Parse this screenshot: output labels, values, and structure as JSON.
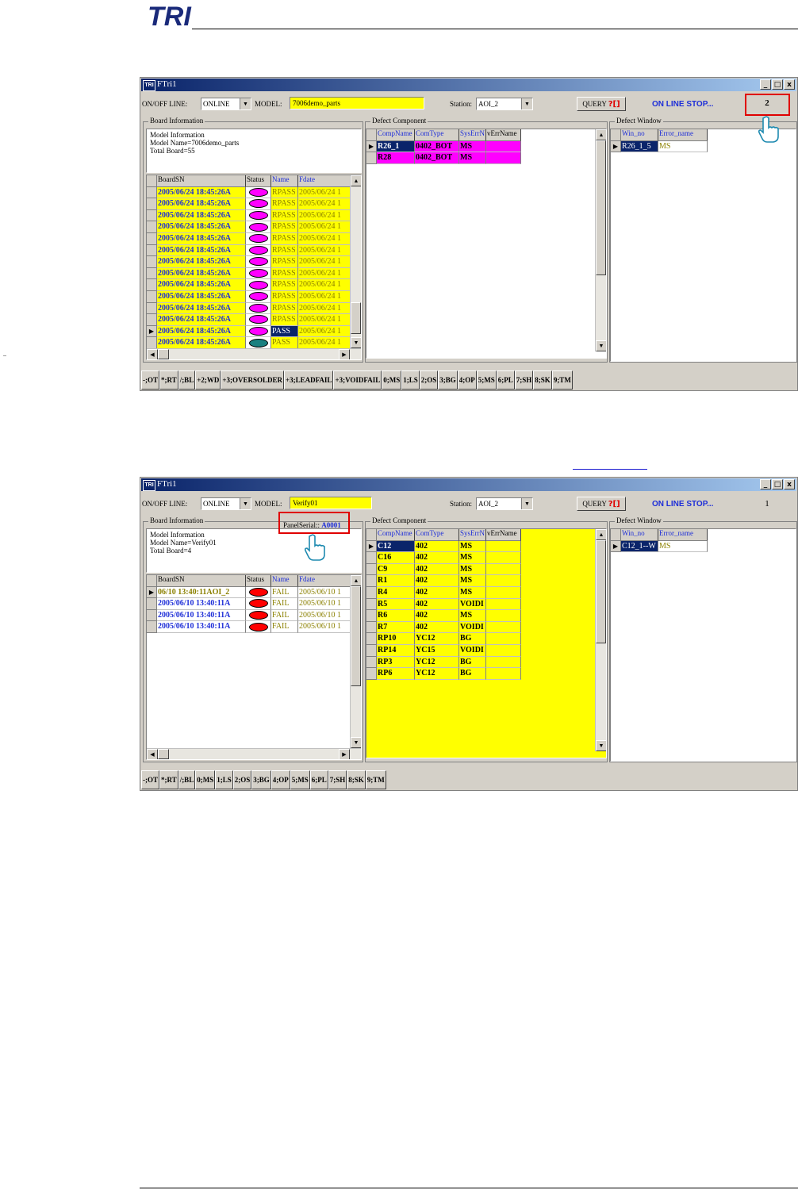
{
  "page": {
    "logo_text": "TRI"
  },
  "colors": {
    "title_gradient_start": "#0a246a",
    "title_gradient_end": "#a6caf0",
    "status_text": "#1e2ed8",
    "highlight": "#e00000",
    "magenta": "#ff00ff",
    "yellow": "#ffff00",
    "window_bg": "#d4d0c8"
  },
  "screen1": {
    "title": "FTri1",
    "title_icon": "TRI",
    "window_buttons": [
      "_",
      "□",
      "x"
    ],
    "online_label": "ON/OFF LINE:",
    "online_value": "ONLINE",
    "model_label": "MODEL:",
    "model_value": "7006demo_parts",
    "station_label": "Station:",
    "station_value": "AOI_2",
    "query_label": "QUERY",
    "query_icon": "?[]",
    "status_text": "ON LINE STOP...",
    "count": "2",
    "board_group": "Board Information",
    "board_info": [
      "Model Information",
      "Model Name=7006demo_parts",
      "Total Board=55"
    ],
    "board_headers": [
      "BoardSN",
      "Status",
      "Name",
      "Fdate"
    ],
    "board_rows": [
      {
        "sn": "2005/06/24 18:45:26A",
        "oval": "magenta",
        "name": "RPASS",
        "fdate": "2005/06/24 1"
      },
      {
        "sn": "2005/06/24 18:45:26A",
        "oval": "magenta",
        "name": "RPASS",
        "fdate": "2005/06/24 1"
      },
      {
        "sn": "2005/06/24 18:45:26A",
        "oval": "magenta",
        "name": "RPASS",
        "fdate": "2005/06/24 1"
      },
      {
        "sn": "2005/06/24 18:45:26A",
        "oval": "magenta",
        "name": "RPASS",
        "fdate": "2005/06/24 1"
      },
      {
        "sn": "2005/06/24 18:45:26A",
        "oval": "magenta",
        "name": "RPASS",
        "fdate": "2005/06/24 1"
      },
      {
        "sn": "2005/06/24 18:45:26A",
        "oval": "magenta",
        "name": "RPASS",
        "fdate": "2005/06/24 1"
      },
      {
        "sn": "2005/06/24 18:45:26A",
        "oval": "magenta",
        "name": "RPASS",
        "fdate": "2005/06/24 1"
      },
      {
        "sn": "2005/06/24 18:45:26A",
        "oval": "magenta",
        "name": "RPASS",
        "fdate": "2005/06/24 1"
      },
      {
        "sn": "2005/06/24 18:45:26A",
        "oval": "magenta",
        "name": "RPASS",
        "fdate": "2005/06/24 1"
      },
      {
        "sn": "2005/06/24 18:45:26A",
        "oval": "magenta",
        "name": "RPASS",
        "fdate": "2005/06/24 1"
      },
      {
        "sn": "2005/06/24 18:45:26A",
        "oval": "magenta",
        "name": "RPASS",
        "fdate": "2005/06/24 1"
      },
      {
        "sn": "2005/06/24 18:45:26A",
        "oval": "magenta",
        "name": "RPASS",
        "fdate": "2005/06/24 1"
      },
      {
        "sn": "2005/06/24 18:45:26A",
        "oval": "magenta",
        "name": "PASS",
        "fdate": "2005/06/24 1"
      },
      {
        "sn": "2005/06/24 18:45:26A",
        "oval": "teal",
        "name": "PASS",
        "fdate": "2005/06/24 1"
      }
    ],
    "defect_group": "Defect Component",
    "defect_headers": [
      "CompName",
      "ComType",
      "SysErrN",
      "vErrName"
    ],
    "defect_rows": [
      [
        "R26_1",
        "0402_BOT",
        "MS",
        ""
      ],
      [
        "R28",
        "0402_BOT",
        "MS",
        ""
      ]
    ],
    "window_group": "Defect Window",
    "window_headers": [
      "Win_no",
      "Error_name"
    ],
    "window_rows": [
      [
        "R26_1_5",
        "MS"
      ]
    ],
    "keys": [
      "-;OT",
      "*;RT",
      "/;BL",
      "+2;WD",
      "+3;OVERSOLDER",
      "+3;LEADFAIL",
      "+3;VOIDFAIL",
      "0;MS",
      "1;LS",
      "2;OS",
      "3;BG",
      "4;OP",
      "5;MS",
      "6;PL",
      "7;SH",
      "8;SK",
      "9;TM"
    ]
  },
  "screen2": {
    "title": "FTri1",
    "title_icon": "TRI",
    "window_buttons": [
      "_",
      "□",
      "x"
    ],
    "online_label": "ON/OFF LINE:",
    "online_value": "ONLINE",
    "model_label": "MODEL:",
    "model_value": "Verify01",
    "station_label": "Station:",
    "station_value": "AOI_2",
    "query_label": "QUERY",
    "query_icon": "?[]",
    "status_text": "ON LINE STOP...",
    "count": "1",
    "panel_serial_label": "PanelSerial::",
    "panel_serial_value": "A0001",
    "board_group": "Board Information",
    "board_info": [
      "Model Information",
      "Model Name=Verify01",
      "Total Board=4"
    ],
    "board_headers": [
      "BoardSN",
      "Status",
      "Name",
      "Fdate"
    ],
    "board_rows": [
      {
        "sn": "06/10 13:40:11AOI_2",
        "oval": "red",
        "name": "FAIL",
        "fdate": "2005/06/10 1"
      },
      {
        "sn": "2005/06/10 13:40:11A",
        "oval": "red",
        "name": "FAIL",
        "fdate": "2005/06/10 1"
      },
      {
        "sn": "2005/06/10 13:40:11A",
        "oval": "red",
        "name": "FAIL",
        "fdate": "2005/06/10 1"
      },
      {
        "sn": "2005/06/10 13:40:11A",
        "oval": "red",
        "name": "FAIL",
        "fdate": "2005/06/10 1"
      }
    ],
    "defect_group": "Defect Component",
    "defect_headers": [
      "CompName",
      "ComType",
      "SysErrN",
      "vErrName"
    ],
    "defect_rows": [
      [
        "C12",
        "402",
        "MS",
        ""
      ],
      [
        "C16",
        "402",
        "MS",
        ""
      ],
      [
        "C9",
        "402",
        "MS",
        ""
      ],
      [
        "R1",
        "402",
        "MS",
        ""
      ],
      [
        "R4",
        "402",
        "MS",
        ""
      ],
      [
        "R5",
        "402",
        "VOIDI",
        ""
      ],
      [
        "R6",
        "402",
        "MS",
        ""
      ],
      [
        "R7",
        "402",
        "VOIDI",
        ""
      ],
      [
        "RP10",
        "YC12",
        "BG",
        ""
      ],
      [
        "RP14",
        "YC15",
        "VOIDI",
        ""
      ],
      [
        "RP3",
        "YC12",
        "BG",
        ""
      ],
      [
        "RP6",
        "YC12",
        "BG",
        ""
      ]
    ],
    "window_group": "Defect Window",
    "window_headers": [
      "Win_no",
      "Error_name"
    ],
    "window_rows": [
      [
        "C12_1--W",
        "MS"
      ]
    ],
    "keys": [
      "-;OT",
      "*;RT",
      "/;BL",
      "0;MS",
      "1;LS",
      "2;OS",
      "3;BG",
      "4;OP",
      "5;MS",
      "6;PL",
      "7;SH",
      "8;SK",
      "9;TM"
    ]
  }
}
